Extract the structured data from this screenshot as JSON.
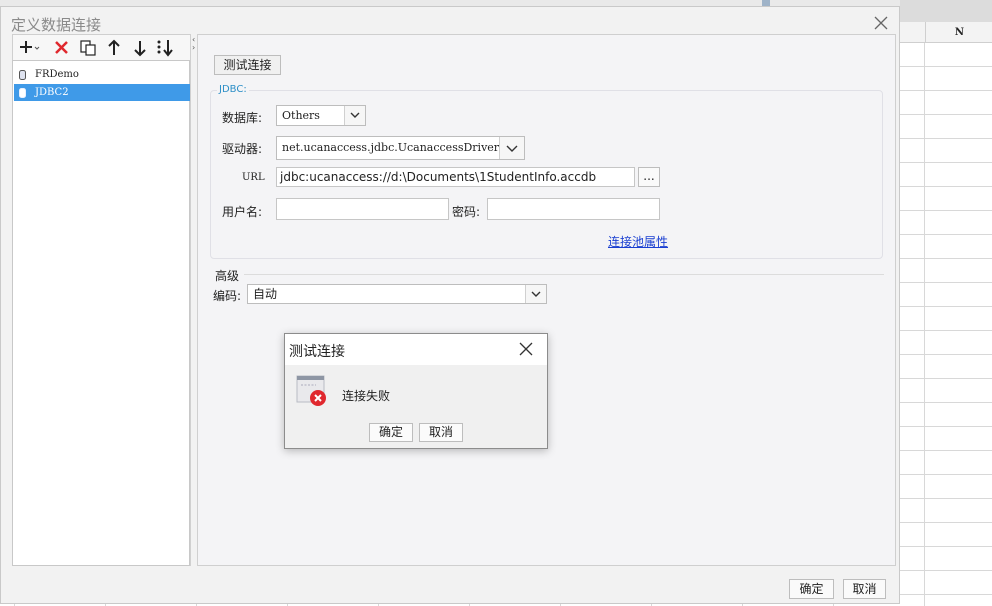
{
  "spreadsheet": {
    "column_letter": "N"
  },
  "dialog": {
    "title": "定义数据连接"
  },
  "toolbar": {
    "buttons": [
      "add-icon",
      "delete-icon",
      "copy-icon",
      "arrow-up-icon",
      "arrow-down-icon",
      "sort-icon"
    ]
  },
  "connections": [
    {
      "label": "FRDemo",
      "selected": false
    },
    {
      "label": "JDBC2",
      "selected": true
    }
  ],
  "form": {
    "test_button": "测试连接",
    "group_title": "JDBC:",
    "database_label": "数据库:",
    "database_value": "Others",
    "driver_label": "驱动器:",
    "driver_value": "net.ucanaccess.jdbc.UcanaccessDriver",
    "url_label": "URL",
    "url_value": "jdbc:ucanaccess://d:\\Documents\\1StudentInfo.accdb",
    "url_more": "...",
    "username_label": "用户名:",
    "username_value": "",
    "password_label": "密码:",
    "password_value": "",
    "pool_link": "连接池属性",
    "advanced_label": "高级",
    "encoding_label": "编码:",
    "encoding_value": "自动"
  },
  "footer": {
    "ok": "确定",
    "cancel": "取消"
  },
  "modal": {
    "title": "测试连接",
    "message": "连接失败",
    "ok": "确定",
    "cancel": "取消",
    "icon": "error-icon"
  },
  "colors": {
    "selection": "#3f9ae8",
    "link": "#1a3fd1",
    "error": "#e0282e",
    "group_title": "#2d8fc7"
  }
}
